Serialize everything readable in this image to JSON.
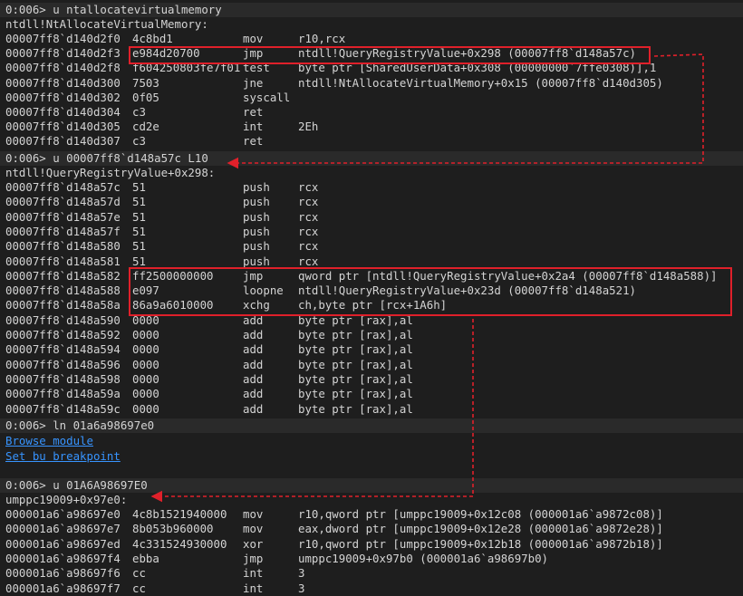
{
  "colors": {
    "background": "#1e1e1e",
    "text": "#d4d4d4",
    "link": "#3794ff",
    "highlight": "#e0202a"
  },
  "block1": {
    "prompt": "0:006> u ntallocatevirtualmemory",
    "label": "ntdll!NtAllocateVirtualMemory:",
    "rows": [
      {
        "addr": "00007ff8`d140d2f0",
        "bytes": "4c8bd1",
        "mnem": "mov",
        "ops": "r10,rcx"
      },
      {
        "addr": "00007ff8`d140d2f3",
        "bytes": "e984d20700",
        "mnem": "jmp",
        "ops": "ntdll!QueryRegistryValue+0x298 (00007ff8`d148a57c)"
      },
      {
        "addr": "00007ff8`d140d2f8",
        "bytes": "f604250803fe7f01",
        "mnem": "test",
        "ops": "byte ptr [SharedUserData+0x308 (00000000`7ffe0308)],1"
      },
      {
        "addr": "00007ff8`d140d300",
        "bytes": "7503",
        "mnem": "jne",
        "ops": "ntdll!NtAllocateVirtualMemory+0x15 (00007ff8`d140d305)"
      },
      {
        "addr": "00007ff8`d140d302",
        "bytes": "0f05",
        "mnem": "syscall",
        "ops": ""
      },
      {
        "addr": "00007ff8`d140d304",
        "bytes": "c3",
        "mnem": "ret",
        "ops": ""
      },
      {
        "addr": "00007ff8`d140d305",
        "bytes": "cd2e",
        "mnem": "int",
        "ops": "2Eh"
      },
      {
        "addr": "00007ff8`d140d307",
        "bytes": "c3",
        "mnem": "ret",
        "ops": ""
      }
    ]
  },
  "block2": {
    "prompt": "0:006> u 00007ff8`d148a57c L10",
    "label": "ntdll!QueryRegistryValue+0x298:",
    "rows": [
      {
        "addr": "00007ff8`d148a57c",
        "bytes": "51",
        "mnem": "push",
        "ops": "rcx"
      },
      {
        "addr": "00007ff8`d148a57d",
        "bytes": "51",
        "mnem": "push",
        "ops": "rcx"
      },
      {
        "addr": "00007ff8`d148a57e",
        "bytes": "51",
        "mnem": "push",
        "ops": "rcx"
      },
      {
        "addr": "00007ff8`d148a57f",
        "bytes": "51",
        "mnem": "push",
        "ops": "rcx"
      },
      {
        "addr": "00007ff8`d148a580",
        "bytes": "51",
        "mnem": "push",
        "ops": "rcx"
      },
      {
        "addr": "00007ff8`d148a581",
        "bytes": "51",
        "mnem": "push",
        "ops": "rcx"
      },
      {
        "addr": "00007ff8`d148a582",
        "bytes": "ff2500000000",
        "mnem": "jmp",
        "ops": "qword ptr [ntdll!QueryRegistryValue+0x2a4 (00007ff8`d148a588)]"
      },
      {
        "addr": "00007ff8`d148a588",
        "bytes": "e097",
        "mnem": "loopne",
        "ops": "ntdll!QueryRegistryValue+0x23d (00007ff8`d148a521)"
      },
      {
        "addr": "00007ff8`d148a58a",
        "bytes": "86a9a6010000",
        "mnem": "xchg",
        "ops": "ch,byte ptr [rcx+1A6h]"
      },
      {
        "addr": "00007ff8`d148a590",
        "bytes": "0000",
        "mnem": "add",
        "ops": "byte ptr [rax],al"
      },
      {
        "addr": "00007ff8`d148a592",
        "bytes": "0000",
        "mnem": "add",
        "ops": "byte ptr [rax],al"
      },
      {
        "addr": "00007ff8`d148a594",
        "bytes": "0000",
        "mnem": "add",
        "ops": "byte ptr [rax],al"
      },
      {
        "addr": "00007ff8`d148a596",
        "bytes": "0000",
        "mnem": "add",
        "ops": "byte ptr [rax],al"
      },
      {
        "addr": "00007ff8`d148a598",
        "bytes": "0000",
        "mnem": "add",
        "ops": "byte ptr [rax],al"
      },
      {
        "addr": "00007ff8`d148a59a",
        "bytes": "0000",
        "mnem": "add",
        "ops": "byte ptr [rax],al"
      },
      {
        "addr": "00007ff8`d148a59c",
        "bytes": "0000",
        "mnem": "add",
        "ops": "byte ptr [rax],al"
      }
    ]
  },
  "block3": {
    "prompt": "0:006> ln 01a6a98697e0",
    "links": [
      "Browse module",
      "Set bu breakpoint"
    ]
  },
  "block4": {
    "prompt": "0:006> u 01A6A98697E0",
    "label": "umppc19009+0x97e0:",
    "rows": [
      {
        "addr": "000001a6`a98697e0",
        "bytes": "4c8b1521940000",
        "mnem": "mov",
        "ops": "r10,qword ptr [umppc19009+0x12c08 (000001a6`a9872c08)]"
      },
      {
        "addr": "000001a6`a98697e7",
        "bytes": "8b053b960000",
        "mnem": "mov",
        "ops": "eax,dword ptr [umppc19009+0x12e28 (000001a6`a9872e28)]"
      },
      {
        "addr": "000001a6`a98697ed",
        "bytes": "4c331524930000",
        "mnem": "xor",
        "ops": "r10,qword ptr [umppc19009+0x12b18 (000001a6`a9872b18)]"
      },
      {
        "addr": "000001a6`a98697f4",
        "bytes": "ebba",
        "mnem": "jmp",
        "ops": "umppc19009+0x97b0 (000001a6`a98697b0)"
      },
      {
        "addr": "000001a6`a98697f6",
        "bytes": "cc",
        "mnem": "int",
        "ops": "3"
      },
      {
        "addr": "000001a6`a98697f7",
        "bytes": "cc",
        "mnem": "int",
        "ops": "3"
      }
    ]
  }
}
